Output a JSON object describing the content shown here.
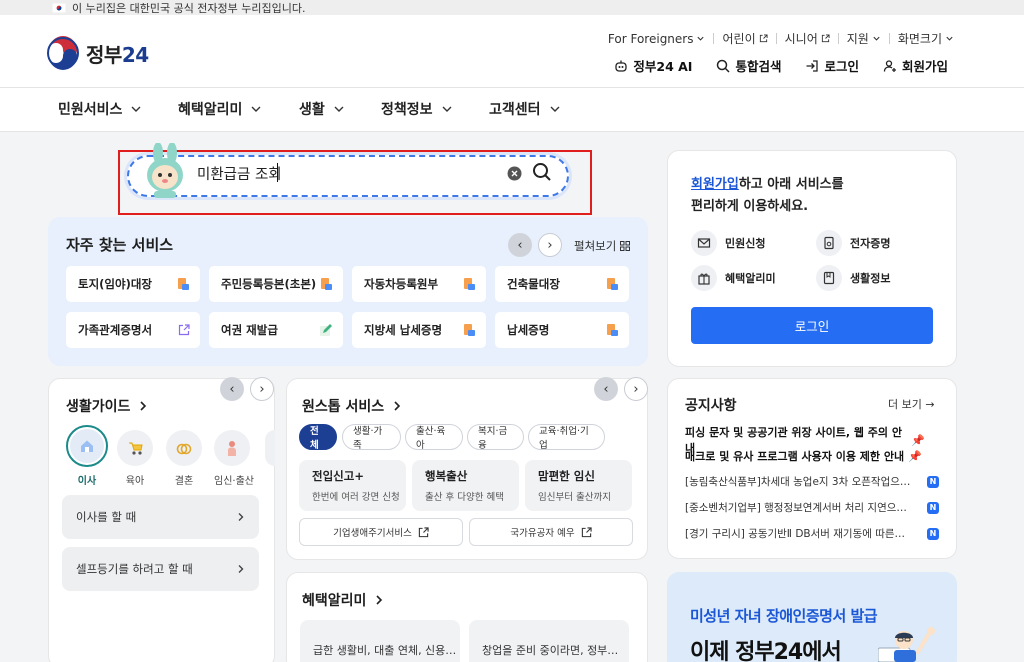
{
  "banner": {
    "text": "이 누리집은 대한민국 공식 전자정부 누리집입니다."
  },
  "header": {
    "logo_text": "정부",
    "logo_num": "24",
    "util_links": [
      "For Foreigners",
      "어린이",
      "시니어",
      "지원",
      "화면크기"
    ],
    "main_links": [
      "정부24 AI",
      "통합검색",
      "로그인",
      "회원가입"
    ]
  },
  "nav": {
    "items": [
      "민원서비스",
      "혜택알리미",
      "생활",
      "정책정보",
      "고객센터"
    ]
  },
  "search": {
    "value": "미환급금 조회"
  },
  "frequent": {
    "title": "자주 찾는 서비스",
    "spread_label": "펼쳐보기",
    "items": [
      "토지(임야)대장",
      "주민등록등본(초본)",
      "자동차등록원부",
      "건축물대장",
      "가족관계증명서",
      "여권 재발급",
      "지방세 납세증명",
      "납세증명"
    ]
  },
  "login_box": {
    "link": "회원가입",
    "line1_rest": "하고 아래 서비스를",
    "line2": "편리하게 이용하세요.",
    "features": [
      "민원신청",
      "전자증명",
      "혜택알리미",
      "생활정보"
    ],
    "button": "로그인"
  },
  "life_guide": {
    "title": "생활가이드",
    "categories": [
      "이사",
      "육아",
      "결혼",
      "임신·출산"
    ],
    "rows": [
      "이사를 할 때",
      "셀프등기를 하려고 할 때"
    ]
  },
  "onestop": {
    "title": "원스톱 서비스",
    "chips": [
      "전체",
      "생활·가족",
      "출산·육아",
      "복지·금융",
      "교육·취업·기업"
    ],
    "tiles": [
      {
        "title": "전입신고+",
        "sub": "한번에 여러 강면 신청"
      },
      {
        "title": "행복출산",
        "sub": "출산 후 다양한 혜택"
      },
      {
        "title": "맘편한 임신",
        "sub": "임신부터 출산까지"
      }
    ],
    "links": [
      "기업생애주기서비스",
      "국가유공자 예우"
    ]
  },
  "benefit": {
    "title": "혜택알리미",
    "tiles": [
      "급한 생활비, 대출 연체, 신용…",
      "창업을 준비 중이라면, 정부…"
    ]
  },
  "notices": {
    "title": "공지사항",
    "more": "더 보기",
    "items": [
      {
        "text": "피싱 문자 및 공공기관 위장 사이트, 웹 주의 안내",
        "pinned": true
      },
      {
        "text": "매크로 및 유사 프로그램 사용자 이용 제한 안내",
        "pinned": true
      },
      {
        "text": "[농림축산식품부]차세대 농업e지 3차 오픈작업으…",
        "badge": "N"
      },
      {
        "text": "[중소벤처기업부] 행정정보연계서버 처리 지연으…",
        "badge": "N"
      },
      {
        "text": "[경기 구리시] 공동기반Ⅱ DB서버 재기동에 따른…",
        "badge": "N"
      }
    ]
  },
  "promo": {
    "line1": "미성년 자녀 장애인증명서 발급",
    "line2": "이제 정부24에서"
  },
  "colors": {
    "primary": "#256ef4",
    "navy": "#1c3f94",
    "highlight": "#e01e1e"
  }
}
